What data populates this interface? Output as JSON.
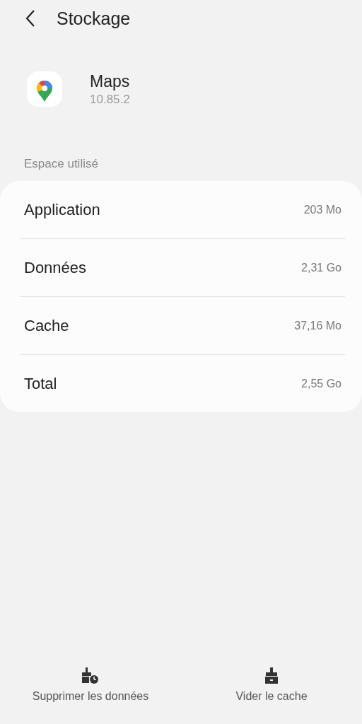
{
  "header": {
    "title": "Stockage"
  },
  "app": {
    "name": "Maps",
    "version": "10.85.2"
  },
  "section_label": "Espace utilisé",
  "rows": [
    {
      "label": "Application",
      "value": "203 Mo"
    },
    {
      "label": "Données",
      "value": "2,31 Go"
    },
    {
      "label": "Cache",
      "value": "37,16 Mo"
    },
    {
      "label": "Total",
      "value": "2,55 Go"
    }
  ],
  "actions": [
    {
      "kind": "clear-data",
      "label": "Supprimer les données"
    },
    {
      "kind": "clear-cache",
      "label": "Vider le cache"
    }
  ]
}
